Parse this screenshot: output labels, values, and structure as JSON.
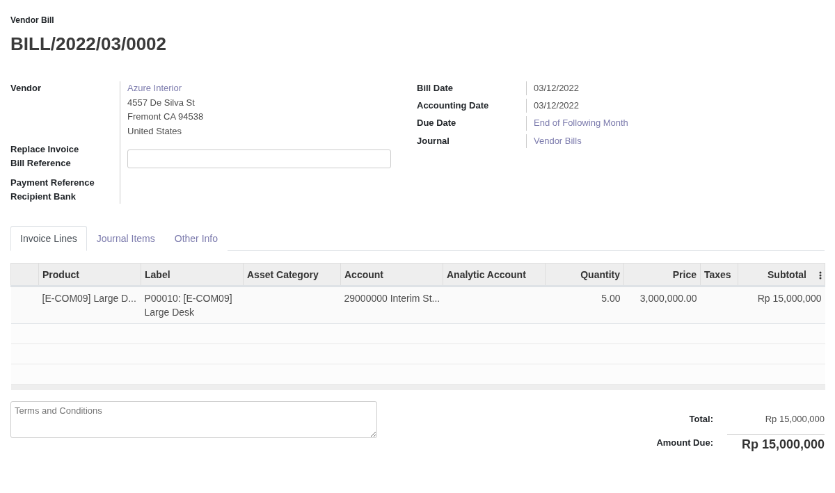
{
  "header": {
    "subtitle": "Vendor Bill",
    "title": "BILL/2022/03/0002"
  },
  "left_fields": [
    {
      "label": "Vendor",
      "kind": "partner",
      "link": "Azure Interior",
      "lines": [
        "4557 De Silva St",
        "Fremont CA 94538",
        "United States"
      ]
    },
    {
      "label": "Replace Invoice",
      "kind": "empty"
    },
    {
      "label": "Bill Reference",
      "kind": "input"
    },
    {
      "label": "Payment Reference",
      "kind": "empty"
    },
    {
      "label": "Recipient Bank",
      "kind": "empty"
    }
  ],
  "right_fields": [
    {
      "label": "Bill Date",
      "value": "03/12/2022",
      "link": false
    },
    {
      "label": "Accounting Date",
      "value": "03/12/2022",
      "link": false
    },
    {
      "label": "Due Date",
      "value": "End of Following Month",
      "link": true
    },
    {
      "label": "Journal",
      "value": "Vendor Bills",
      "link": true
    }
  ],
  "tabs": [
    {
      "label": "Invoice Lines",
      "selected": true
    },
    {
      "label": "Journal Items",
      "selected": false
    },
    {
      "label": "Other Info",
      "selected": false
    }
  ],
  "table": {
    "columns": [
      {
        "label": "Product",
        "kind": "text"
      },
      {
        "label": "Label",
        "kind": "text"
      },
      {
        "label": "Asset Category",
        "kind": "text"
      },
      {
        "label": "Account",
        "kind": "text"
      },
      {
        "label": "Analytic Account",
        "kind": "text"
      },
      {
        "label": "Quantity",
        "kind": "number"
      },
      {
        "label": "Price",
        "kind": "number"
      },
      {
        "label": "Taxes",
        "kind": "text"
      },
      {
        "label": "Subtotal",
        "kind": "number"
      }
    ],
    "rows": [
      [
        "[E-COM09] Large D...",
        "P00010: [E-COM09] Large Desk",
        "",
        "29000000 Interim St...",
        "",
        "5.00",
        "3,000,000.00",
        "",
        "Rp 15,000,000"
      ]
    ]
  },
  "terms": {
    "placeholder": "Terms and Conditions"
  },
  "totals": [
    {
      "label": "Total:",
      "value": "Rp 15,000,000",
      "kind": "plain"
    },
    {
      "label": "Amount Due:",
      "value": "Rp 15,000,000",
      "kind": "due"
    }
  ]
}
